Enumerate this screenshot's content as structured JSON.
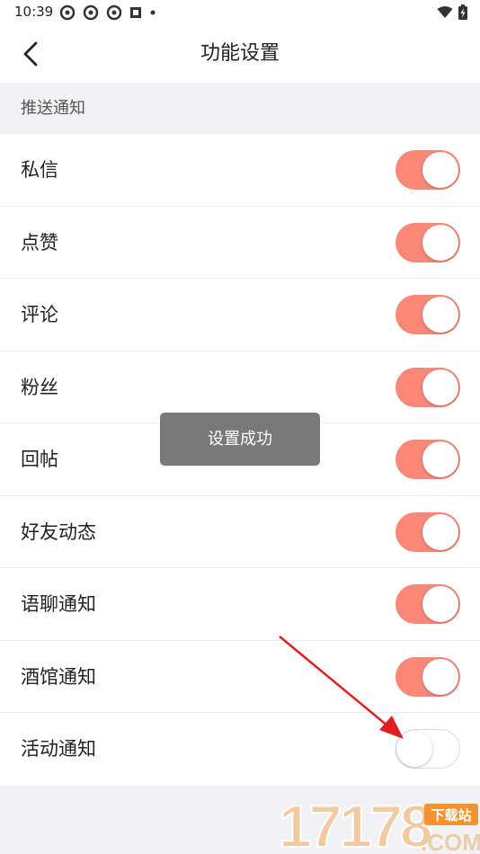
{
  "status_bar": {
    "time": "10:39"
  },
  "header": {
    "title": "功能设置"
  },
  "section": {
    "title": "推送通知"
  },
  "settings": [
    {
      "label": "私信",
      "enabled": true
    },
    {
      "label": "点赞",
      "enabled": true
    },
    {
      "label": "评论",
      "enabled": true
    },
    {
      "label": "粉丝",
      "enabled": true
    },
    {
      "label": "回帖",
      "enabled": true
    },
    {
      "label": "好友动态",
      "enabled": true
    },
    {
      "label": "语聊通知",
      "enabled": true
    },
    {
      "label": "酒馆通知",
      "enabled": true
    },
    {
      "label": "活动通知",
      "enabled": false
    }
  ],
  "toast": {
    "message": "设置成功"
  },
  "colors": {
    "toggle_on": "#fa8878",
    "arrow": "#e02020",
    "background": "#f2f2f4"
  },
  "watermark": {
    "number": "17178",
    "tag": "下载站",
    "domain": ".COM"
  }
}
